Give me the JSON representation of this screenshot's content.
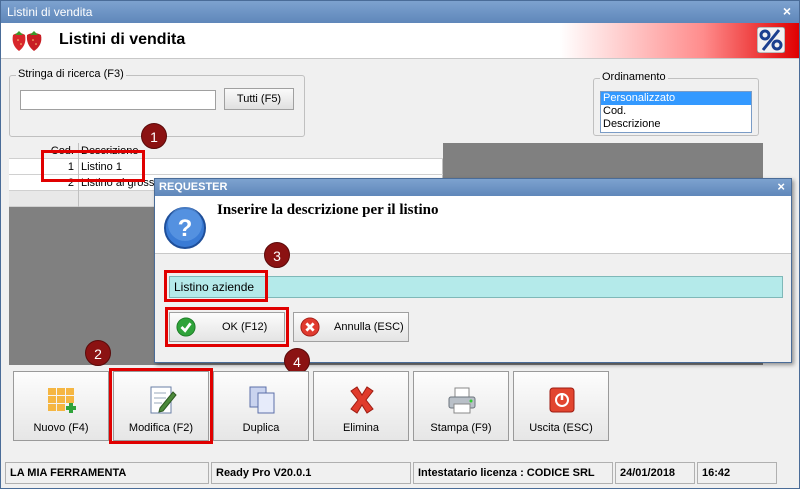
{
  "window": {
    "title": "Listini di vendita",
    "close_glyph": "×"
  },
  "header": {
    "title": "Listini di vendita",
    "logo_icon": "strawberries-icon",
    "right_icon": "percent-icon",
    "accent": "#e00000"
  },
  "search": {
    "label": "Stringa di ricerca (F3)",
    "value": "",
    "button": "Tutti (F5)"
  },
  "ordering": {
    "label": "Ordinamento",
    "options": [
      "Personalizzato",
      "Cod.",
      "Descrizione"
    ],
    "selected": "Personalizzato"
  },
  "grid": {
    "headers": [
      "Cod.",
      "Descrizione"
    ],
    "rows": [
      {
        "cod": "1",
        "descr": "Listino 1"
      },
      {
        "cod": "2",
        "descr": "Listino al grosso"
      }
    ]
  },
  "dialog": {
    "title": "REQUESTER",
    "close_glyph": "×",
    "message": "Inserire la descrizione per il listino",
    "input_value": "Listino aziende",
    "ok_label": "OK (F12)",
    "cancel_label": "Annulla (ESC)"
  },
  "annotations": [
    "1",
    "2",
    "3",
    "4"
  ],
  "toolbar": [
    {
      "label": "Nuovo (F4)",
      "icon": "new-grid-icon"
    },
    {
      "label": "Modifica (F2)",
      "icon": "edit-pencil-icon"
    },
    {
      "label": "Duplica",
      "icon": "duplicate-icon"
    },
    {
      "label": "Elimina",
      "icon": "delete-x-icon"
    },
    {
      "label": "Stampa (F9)",
      "icon": "printer-icon"
    },
    {
      "label": "Uscita (ESC)",
      "icon": "exit-icon"
    }
  ],
  "status": {
    "company": "LA MIA FERRAMENTA",
    "version": "Ready Pro V20.0.1",
    "license": "Intestatario licenza : CODICE SRL",
    "date": "24/01/2018",
    "time": "16:42"
  }
}
